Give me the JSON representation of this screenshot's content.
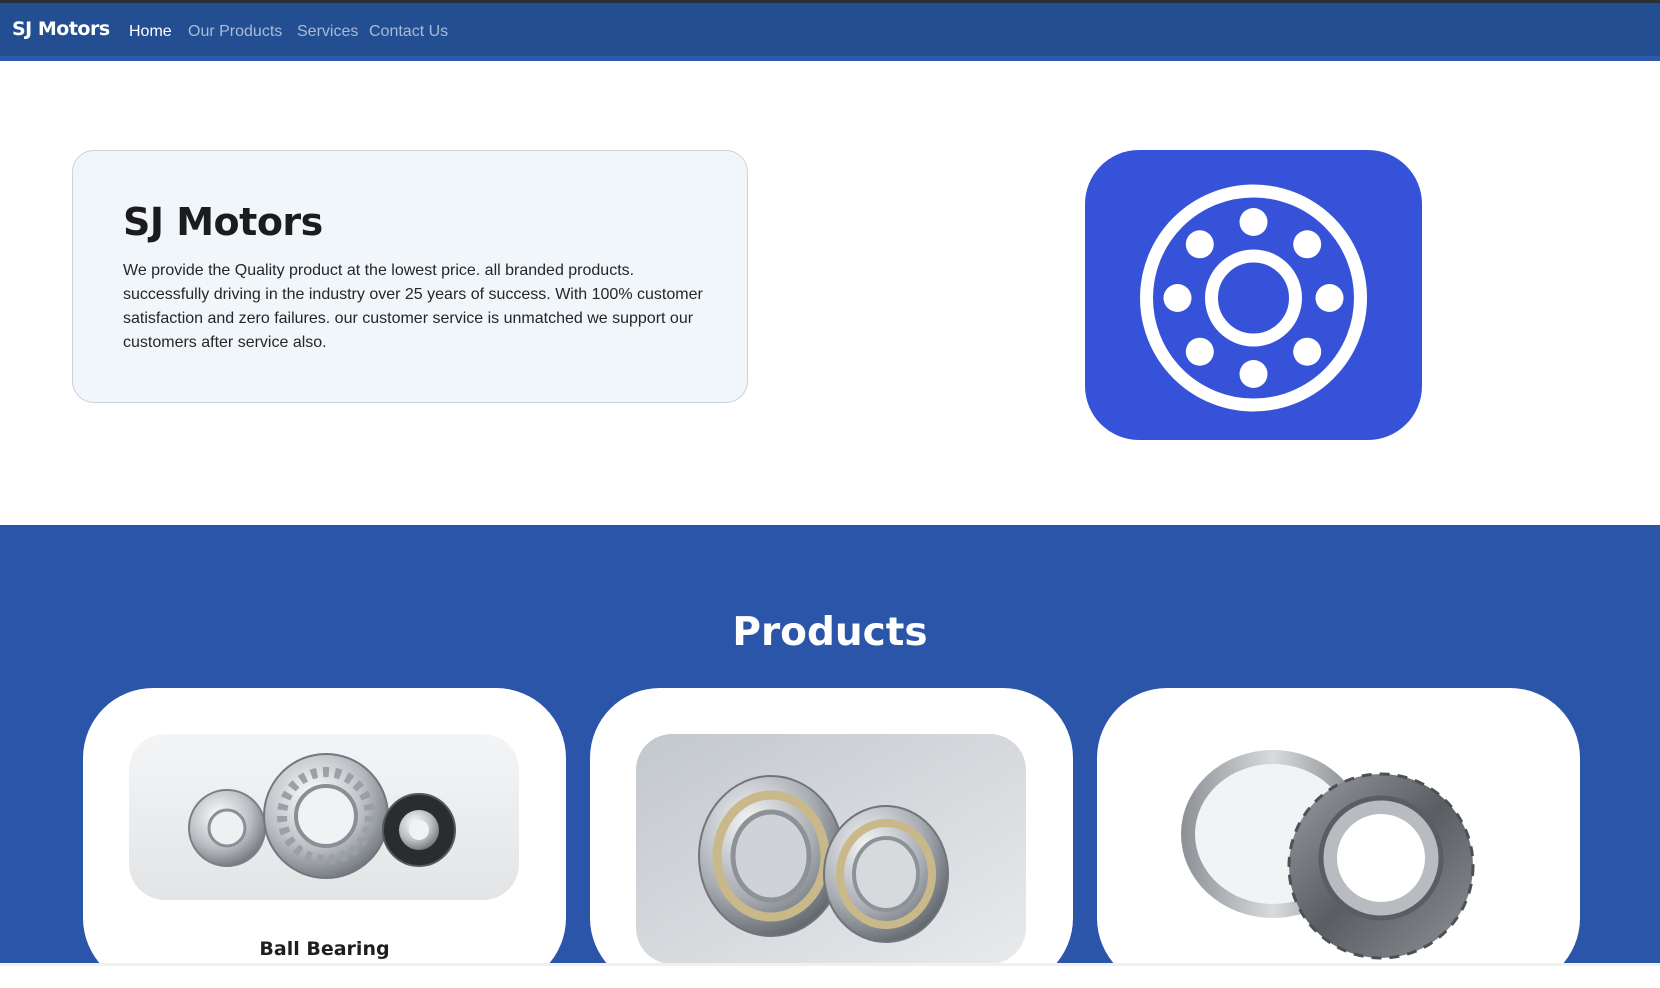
{
  "navbar": {
    "brand": "SJ Motors",
    "links": [
      {
        "label": "Home",
        "active": true
      },
      {
        "label": "Our Products",
        "active": false
      },
      {
        "label": "Services",
        "active": false
      },
      {
        "label": "Contact Us",
        "active": false
      }
    ]
  },
  "about": {
    "title": "SJ Motors",
    "text": "We provide the Quality product at the lowest price. all branded products. successfully driving in the industry over 25 years of success. With 100% customer satisfaction and zero failures. our customer service is unmatched we support our customers after service also."
  },
  "logo": {
    "icon": "bearing-icon",
    "color": "#3652d8"
  },
  "products": {
    "title": "Products",
    "items": [
      {
        "name": "Ball Bearing",
        "image": "ball-bearing-image"
      },
      {
        "name": "",
        "image": "cylindrical-roller-bearing-image"
      },
      {
        "name": "",
        "image": "tapered-roller-bearing-image"
      }
    ]
  },
  "colors": {
    "navbar": "#234e91",
    "accent": "#2b55a9",
    "logo_tile": "#3652d8"
  }
}
